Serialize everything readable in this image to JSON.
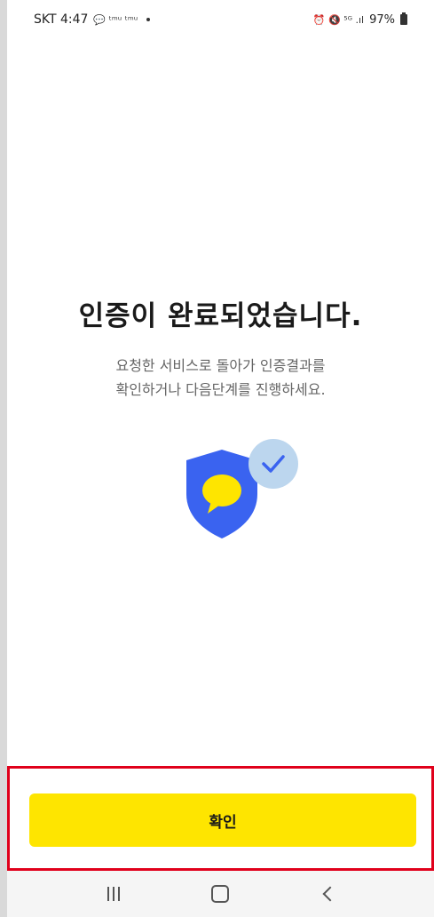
{
  "status_bar": {
    "carrier_time": "SKT 4:47",
    "left_icons": "💬 ᵗᵐᵘ ᵗᵐᵘ",
    "right_icons": "⏰ 🔇 ⁵ᴳ .ıl",
    "battery": "97%"
  },
  "main": {
    "title": "인증이 완료되었습니다.",
    "subtitle_line1": "요청한 서비스로 돌아가 인증결과를",
    "subtitle_line2": "확인하거나 다음단계를 진행하세요."
  },
  "colors": {
    "accent": "#fee500",
    "shield": "#3a63f0",
    "check_badge": "#bcd6ee",
    "highlight_border": "#e0001b"
  },
  "confirm_button": {
    "label": "확인"
  },
  "nav_bar": {
    "recents": "recents-icon",
    "home": "home-icon",
    "back": "back-icon"
  }
}
